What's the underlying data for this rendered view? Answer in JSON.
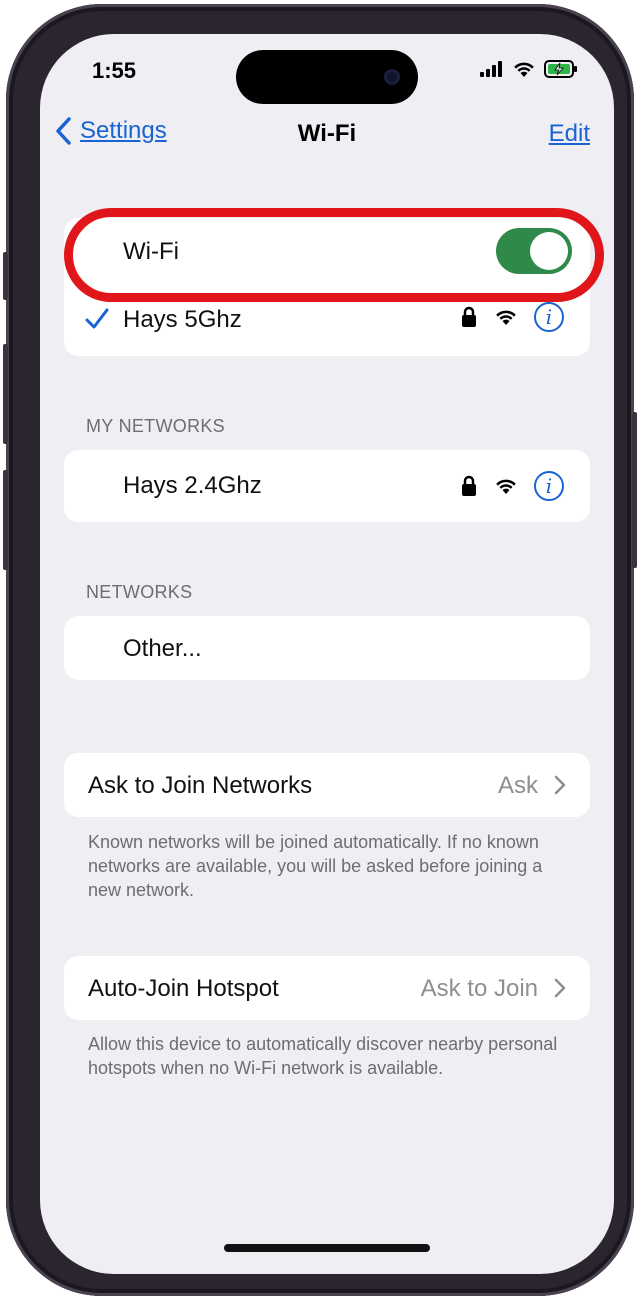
{
  "status_bar": {
    "time": "1:55"
  },
  "nav": {
    "back_label": "Settings",
    "title": "Wi-Fi",
    "edit_label": "Edit"
  },
  "wifi_group": {
    "toggle_label": "Wi-Fi",
    "toggle_on": true,
    "connected_network": "Hays 5Ghz"
  },
  "my_networks": {
    "header": "MY NETWORKS",
    "items": [
      {
        "name": "Hays 2.4Ghz"
      }
    ]
  },
  "networks": {
    "header": "NETWORKS",
    "other_label": "Other..."
  },
  "ask_to_join": {
    "label": "Ask to Join Networks",
    "value": "Ask",
    "footer": "Known networks will be joined automatically. If no known networks are available, you will be asked before joining a new network."
  },
  "auto_join": {
    "label": "Auto-Join Hotspot",
    "value": "Ask to Join",
    "footer": "Allow this device to automatically discover nearby personal hotspots when no Wi-Fi network is available."
  },
  "colors": {
    "accent": "#1a63d3",
    "toggle": "#2f8a4a",
    "highlight": "#e1161a",
    "background": "#eeeef3"
  }
}
